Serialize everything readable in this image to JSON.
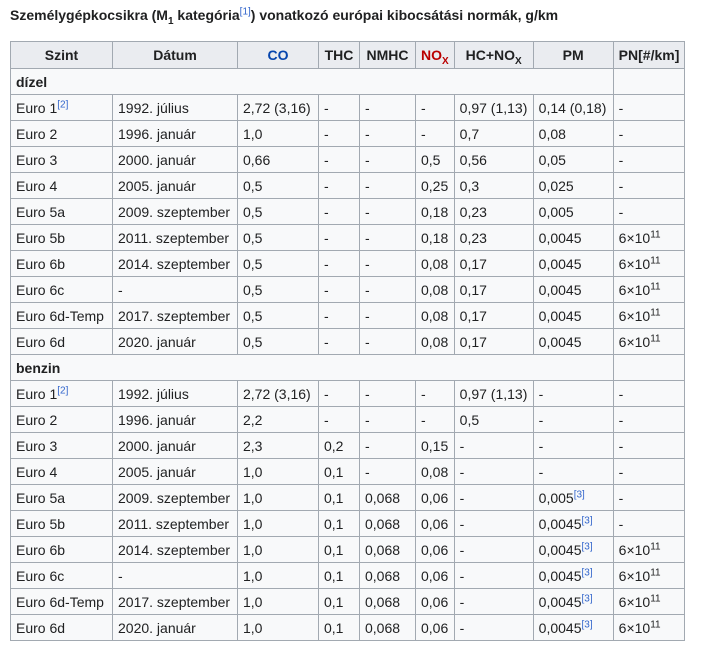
{
  "caption": {
    "before": "Személygépkocsikra (M",
    "sub": "1",
    "mid": " kategória",
    "ref": "[1]",
    "after": ") vonatkozó európai kibocsátási normák, g/km"
  },
  "headers": {
    "szint": "Szint",
    "datum": "Dátum",
    "co": "CO",
    "thc": "THC",
    "nmhc": "NMHC",
    "nox_main": "NO",
    "nox_sub": "X",
    "hcnox_main": "HC+NO",
    "hcnox_sub": "X",
    "pm": "PM",
    "pn": "PN[#/km]"
  },
  "groups": {
    "dizel": "dízel",
    "benzin": "benzin"
  },
  "diesel_rows": [
    {
      "szint": "Euro 1",
      "szint_ref": "[2]",
      "datum": "1992. július",
      "co": "2,72 (3,16)",
      "thc": "-",
      "nmhc": "-",
      "nox": "-",
      "hcnox": "0,97 (1,13)",
      "pm": "0,14 (0,18)",
      "pm_ref": "",
      "pn": "-",
      "pn_exp": ""
    },
    {
      "szint": "Euro 2",
      "szint_ref": "",
      "datum": "1996. január",
      "co": "1,0",
      "thc": "-",
      "nmhc": "-",
      "nox": "-",
      "hcnox": "0,7",
      "pm": "0,08",
      "pm_ref": "",
      "pn": "-",
      "pn_exp": ""
    },
    {
      "szint": "Euro 3",
      "szint_ref": "",
      "datum": "2000. január",
      "co": "0,66",
      "thc": "-",
      "nmhc": "-",
      "nox": "0,5",
      "hcnox": "0,56",
      "pm": "0,05",
      "pm_ref": "",
      "pn": "-",
      "pn_exp": ""
    },
    {
      "szint": "Euro 4",
      "szint_ref": "",
      "datum": "2005. január",
      "co": "0,5",
      "thc": "-",
      "nmhc": "-",
      "nox": "0,25",
      "hcnox": "0,3",
      "pm": "0,025",
      "pm_ref": "",
      "pn": "-",
      "pn_exp": ""
    },
    {
      "szint": "Euro 5a",
      "szint_ref": "",
      "datum": "2009. szeptember",
      "co": "0,5",
      "thc": "-",
      "nmhc": "-",
      "nox": "0,18",
      "hcnox": "0,23",
      "pm": "0,005",
      "pm_ref": "",
      "pn": "-",
      "pn_exp": ""
    },
    {
      "szint": "Euro 5b",
      "szint_ref": "",
      "datum": "2011. szeptember",
      "co": "0,5",
      "thc": "-",
      "nmhc": "-",
      "nox": "0,18",
      "hcnox": "0,23",
      "pm": "0,0045",
      "pm_ref": "",
      "pn": "6×10",
      "pn_exp": "11"
    },
    {
      "szint": "Euro 6b",
      "szint_ref": "",
      "datum": "2014. szeptember",
      "co": "0,5",
      "thc": "-",
      "nmhc": "-",
      "nox": "0,08",
      "hcnox": "0,17",
      "pm": "0,0045",
      "pm_ref": "",
      "pn": "6×10",
      "pn_exp": "11"
    },
    {
      "szint": "Euro 6c",
      "szint_ref": "",
      "datum": "-",
      "co": "0,5",
      "thc": "-",
      "nmhc": "-",
      "nox": "0,08",
      "hcnox": "0,17",
      "pm": "0,0045",
      "pm_ref": "",
      "pn": "6×10",
      "pn_exp": "11"
    },
    {
      "szint": "Euro 6d-Temp",
      "szint_ref": "",
      "datum": "2017. szeptember",
      "co": "0,5",
      "thc": "-",
      "nmhc": "-",
      "nox": "0,08",
      "hcnox": "0,17",
      "pm": "0,0045",
      "pm_ref": "",
      "pn": "6×10",
      "pn_exp": "11"
    },
    {
      "szint": "Euro 6d",
      "szint_ref": "",
      "datum": "2020. január",
      "co": "0,5",
      "thc": "-",
      "nmhc": "-",
      "nox": "0,08",
      "hcnox": "0,17",
      "pm": "0,0045",
      "pm_ref": "",
      "pn": "6×10",
      "pn_exp": "11"
    }
  ],
  "petrol_rows": [
    {
      "szint": "Euro 1",
      "szint_ref": "[2]",
      "datum": "1992. július",
      "co": "2,72 (3,16)",
      "thc": "-",
      "nmhc": "-",
      "nox": "-",
      "hcnox": "0,97 (1,13)",
      "pm": "-",
      "pm_ref": "",
      "pn": "-",
      "pn_exp": ""
    },
    {
      "szint": "Euro 2",
      "szint_ref": "",
      "datum": "1996. január",
      "co": "2,2",
      "thc": "-",
      "nmhc": "-",
      "nox": "-",
      "hcnox": "0,5",
      "pm": "-",
      "pm_ref": "",
      "pn": "-",
      "pn_exp": ""
    },
    {
      "szint": "Euro 3",
      "szint_ref": "",
      "datum": "2000. január",
      "co": "2,3",
      "thc": "0,2",
      "nmhc": "-",
      "nox": "0,15",
      "hcnox": "-",
      "pm": "-",
      "pm_ref": "",
      "pn": "-",
      "pn_exp": ""
    },
    {
      "szint": "Euro 4",
      "szint_ref": "",
      "datum": "2005. január",
      "co": "1,0",
      "thc": "0,1",
      "nmhc": "-",
      "nox": "0,08",
      "hcnox": "-",
      "pm": "-",
      "pm_ref": "",
      "pn": "-",
      "pn_exp": ""
    },
    {
      "szint": "Euro 5a",
      "szint_ref": "",
      "datum": "2009. szeptember",
      "co": "1,0",
      "thc": "0,1",
      "nmhc": "0,068",
      "nox": "0,06",
      "hcnox": "-",
      "pm": "0,005",
      "pm_ref": "[3]",
      "pn": "-",
      "pn_exp": ""
    },
    {
      "szint": "Euro 5b",
      "szint_ref": "",
      "datum": "2011. szeptember",
      "co": "1,0",
      "thc": "0,1",
      "nmhc": "0,068",
      "nox": "0,06",
      "hcnox": "-",
      "pm": "0,0045",
      "pm_ref": "[3]",
      "pn": "-",
      "pn_exp": ""
    },
    {
      "szint": "Euro 6b",
      "szint_ref": "",
      "datum": "2014. szeptember",
      "co": "1,0",
      "thc": "0,1",
      "nmhc": "0,068",
      "nox": "0,06",
      "hcnox": "-",
      "pm": "0,0045",
      "pm_ref": "[3]",
      "pn": "6×10",
      "pn_exp": "11"
    },
    {
      "szint": "Euro 6c",
      "szint_ref": "",
      "datum": "-",
      "co": "1,0",
      "thc": "0,1",
      "nmhc": "0,068",
      "nox": "0,06",
      "hcnox": "-",
      "pm": "0,0045",
      "pm_ref": "[3]",
      "pn": "6×10",
      "pn_exp": "11"
    },
    {
      "szint": "Euro 6d-Temp",
      "szint_ref": "",
      "datum": "2017. szeptember",
      "co": "1,0",
      "thc": "0,1",
      "nmhc": "0,068",
      "nox": "0,06",
      "hcnox": "-",
      "pm": "0,0045",
      "pm_ref": "[3]",
      "pn": "6×10",
      "pn_exp": "11"
    },
    {
      "szint": "Euro 6d",
      "szint_ref": "",
      "datum": "2020. január",
      "co": "1,0",
      "thc": "0,1",
      "nmhc": "0,068",
      "nox": "0,06",
      "hcnox": "-",
      "pm": "0,0045",
      "pm_ref": "[3]",
      "pn": "6×10",
      "pn_exp": "11"
    }
  ]
}
